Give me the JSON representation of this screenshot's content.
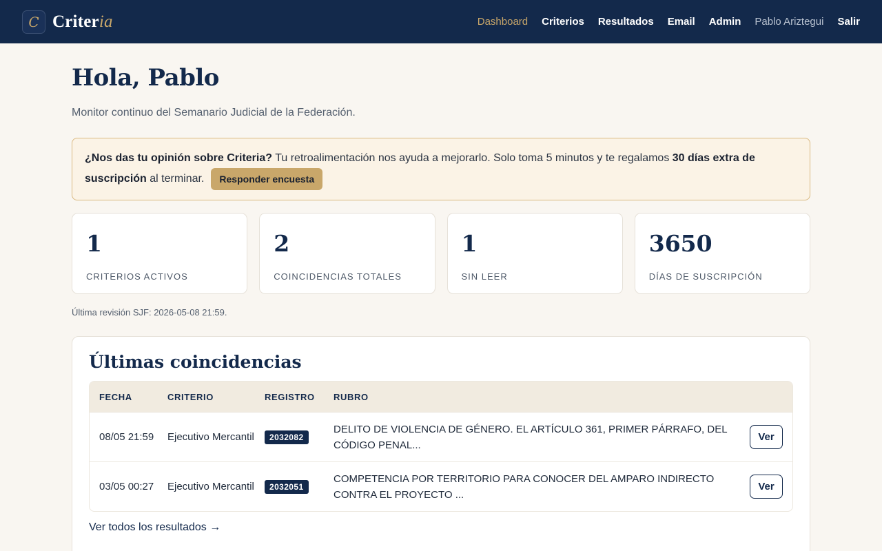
{
  "brand": {
    "logo_letter": "C",
    "name_main": "Criter",
    "name_accent": "ia"
  },
  "nav": {
    "items": [
      "Dashboard",
      "Criterios",
      "Resultados",
      "Email",
      "Admin"
    ],
    "user": "Pablo Ariztegui",
    "logout": "Salir"
  },
  "page": {
    "title": "Hola, Pablo",
    "subtitle": "Monitor continuo del Semanario Judicial de la Federación."
  },
  "survey": {
    "question": "¿Nos das tu opinión sobre Criteria?",
    "text": " Tu retroalimentación nos ayuda a mejorarlo. Solo toma 5 minutos y te regalamos ",
    "bonus": "30 días extra de suscripción",
    "suffix": " al terminar.",
    "button": "Responder encuesta"
  },
  "stats": [
    {
      "value": "1",
      "label": "Criterios activos"
    },
    {
      "value": "2",
      "label": "Coincidencias totales"
    },
    {
      "value": "1",
      "label": "Sin leer"
    },
    {
      "value": "3650",
      "label": "Días de suscripción"
    }
  ],
  "last_check": "Última revisión SJF: 2026-05-08 21:59.",
  "matches": {
    "title": "Últimas coincidencias",
    "columns": [
      "FECHA",
      "CRITERIO",
      "REGISTRO",
      "RUBRO"
    ],
    "rows": [
      {
        "date": "08/05 21:59",
        "criterion": "Ejecutivo Mercantil",
        "registry": "2032082",
        "rubro": "DELITO DE VIOLENCIA DE GÉNERO. EL ARTÍCULO 361, PRIMER PÁRRAFO, DEL CÓDIGO PENAL...",
        "action": "Ver"
      },
      {
        "date": "03/05 00:27",
        "criterion": "Ejecutivo Mercantil",
        "registry": "2032051",
        "rubro": "COMPETENCIA POR TERRITORIO PARA CONOCER DEL AMPARO INDIRECTO CONTRA EL PROYECTO ...",
        "action": "Ver"
      }
    ],
    "see_all": "Ver todos los resultados →"
  },
  "colors": {
    "navy": "#13294b",
    "gold": "#c9a76a",
    "background": "#f9f6f1"
  }
}
